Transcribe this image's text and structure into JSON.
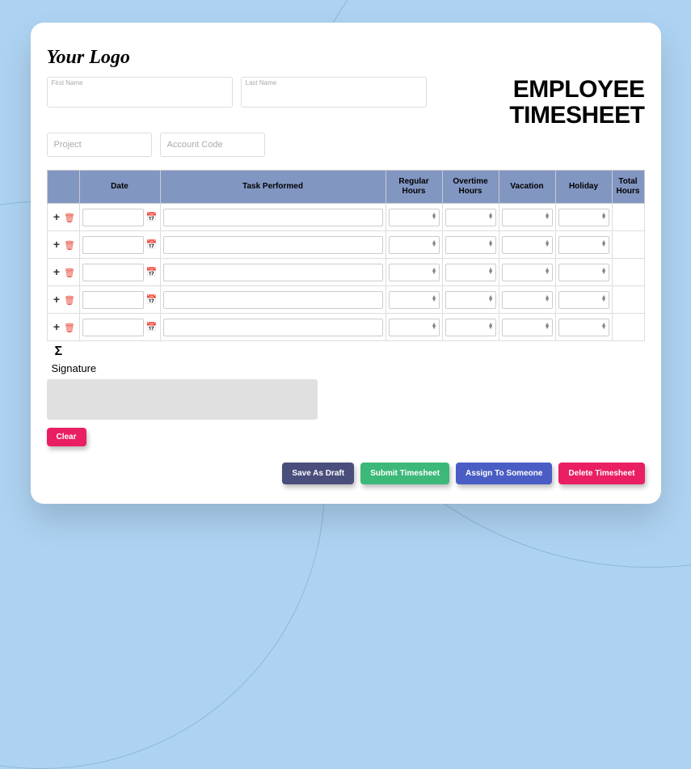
{
  "logo": "Your Logo",
  "title_line1": "EMPLOYEE",
  "title_line2": "TIMESHEET",
  "fields": {
    "first_name_label": "First Name",
    "last_name_label": "Last Name",
    "project_placeholder": "Project",
    "account_code_placeholder": "Account Code"
  },
  "table": {
    "headers": {
      "action": "",
      "date": "Date",
      "task": "Task Performed",
      "regular": "Regular Hours",
      "overtime": "Overtime Hours",
      "vacation": "Vacation",
      "holiday": "Holiday",
      "total": "Total Hours"
    },
    "row_count": 5,
    "sigma": "Σ"
  },
  "signature": {
    "label": "Signature",
    "clear": "Clear"
  },
  "buttons": {
    "draft": "Save As Draft",
    "submit": "Submit Timesheet",
    "assign": "Assign To Someone",
    "delete": "Delete Timesheet"
  }
}
